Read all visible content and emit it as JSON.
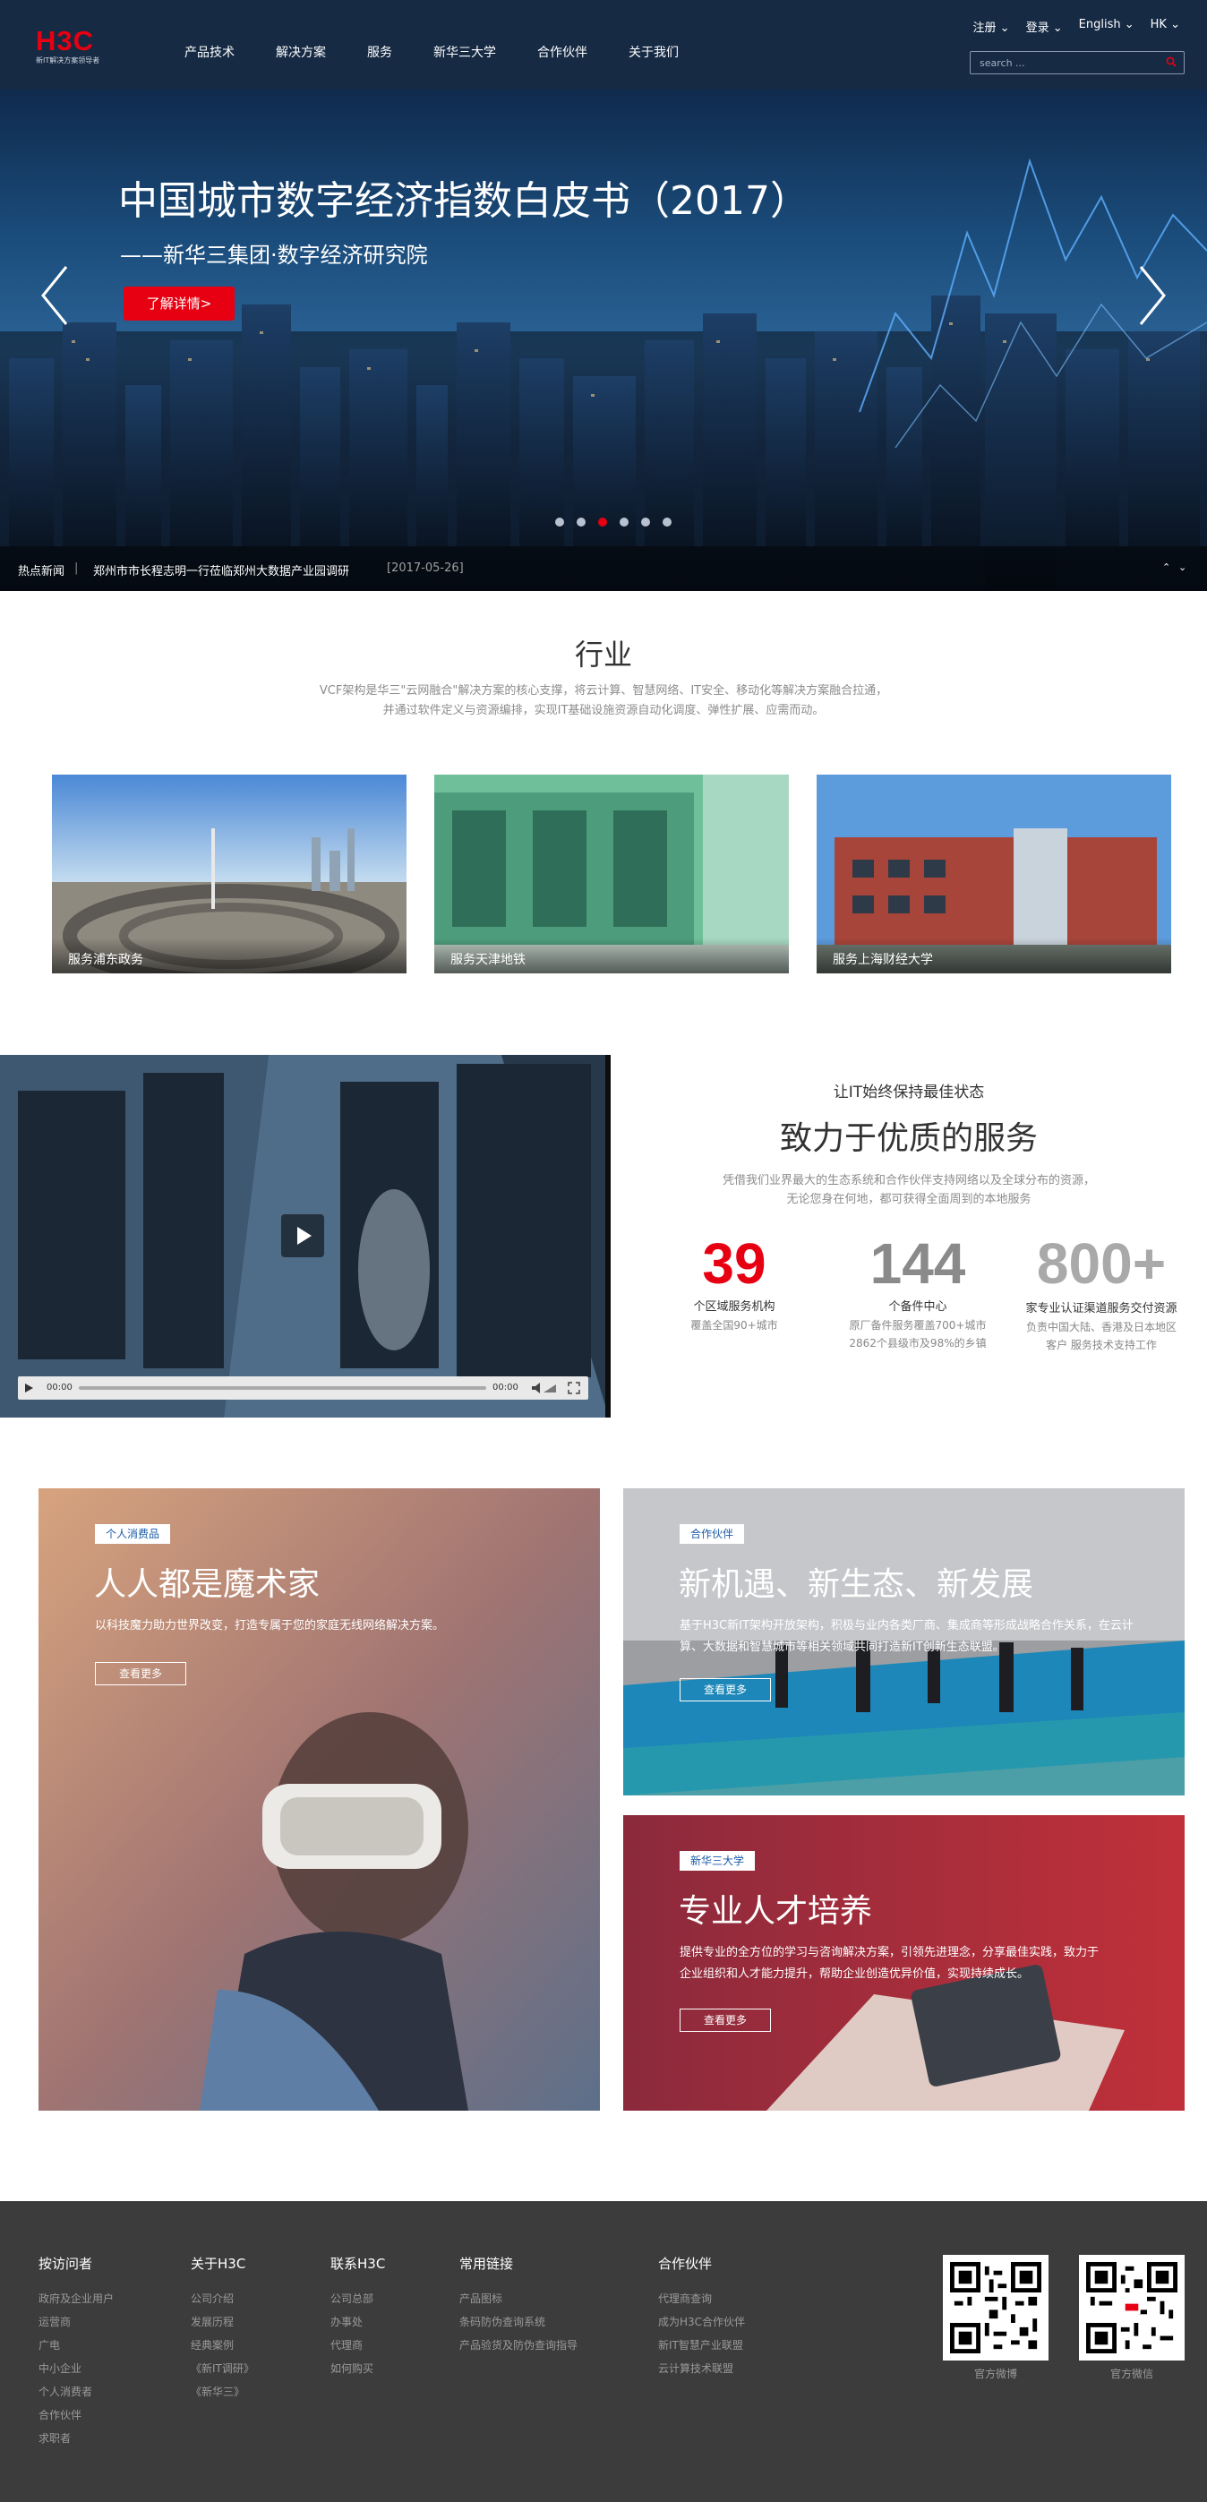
{
  "header": {
    "logo_text": "H3C",
    "logo_tagline": "新IT解决方案领导者",
    "nav": [
      "产品技术",
      "解决方案",
      "服务",
      "新华三大学",
      "合作伙伴",
      "关于我们"
    ],
    "register": "注册",
    "login": "登录",
    "language": "English",
    "region": "HK",
    "search_placeholder": "search ..."
  },
  "hero": {
    "title": "中国城市数字经济指数白皮书（2017）",
    "subtitle": "——新华三集团·数字经济研究院",
    "button": "了解详情>",
    "slide_count": 6,
    "active_slide": 2,
    "news_label": "热点新闻",
    "news_text": "郑州市市长程志明一行莅临郑州大数据产业园调研",
    "news_date": "[2017-05-26]"
  },
  "industry": {
    "title": "行业",
    "desc_line1": "VCF架构是华三\"云网融合\"解决方案的核心支撑，将云计算、智慧网络、IT安全、移动化等解决方案融合拉通，",
    "desc_line2": "并通过软件定义与资源编排，实现IT基础设施资源自动化调度、弹性扩展、应需而动。",
    "cards": [
      {
        "caption": "服务浦东政务"
      },
      {
        "caption": "服务天津地铁"
      },
      {
        "caption": "服务上海财经大学"
      }
    ]
  },
  "service": {
    "kicker": "让IT始终保持最佳状态",
    "title": "致力于优质的服务",
    "desc_line1": "凭借我们业界最大的生态系统和合作伙伴支持网络以及全球分布的资源，",
    "desc_line2": "无论您身在何地，都可获得全面周到的本地服务",
    "video_time_start": "00:00",
    "video_time_end": "00:00",
    "stats": [
      {
        "value": "39",
        "label": "个区域服务机构",
        "sub1": "覆盖全国90+城市",
        "sub2": "",
        "color": "#e60012"
      },
      {
        "value": "144",
        "label": "个备件中心",
        "sub1": "原厂备件服务覆盖700+城市",
        "sub2": "2862个县级市及98%的乡镇",
        "color": "#8a8a8a"
      },
      {
        "value": "800+",
        "label": "家专业认证渠道服务交付资源",
        "sub1": "负责中国大陆、香港及日本地区",
        "sub2": "客户 服务技术支持工作",
        "color": "#a9a9a9"
      }
    ]
  },
  "promos": [
    {
      "badge": "个人消费品",
      "title": "人人都是魔术家",
      "text1": "以科技魔力助力世界改变，打造专属于您的家庭无线网络解决方案。",
      "text2": "",
      "button": "查看更多"
    },
    {
      "badge": "合作伙伴",
      "title": "新机遇、新生态、新发展",
      "text1": "基于H3C新IT架构开放架构，积极与业内各类厂商、集成商等形成战略合作关系，在云计",
      "text2": "算、大数据和智慧城市等相关领域共同打造新IT创新生态联盟。",
      "button": "查看更多"
    },
    {
      "badge": "新华三大学",
      "title": "专业人才培养",
      "text1": "提供专业的全方位的学习与咨询解决方案，引领先进理念，分享最佳实践，致力于",
      "text2": "企业组织和人才能力提升，帮助企业创造优异价值，实现持续成长。",
      "button": "查看更多"
    }
  ],
  "footer": {
    "columns": [
      {
        "title": "按访问者",
        "items": [
          "政府及企业用户",
          "运营商",
          "广电",
          "中小企业",
          "个人消费者",
          "合作伙伴",
          "求职者"
        ]
      },
      {
        "title": "关于H3C",
        "items": [
          "公司介绍",
          "发展历程",
          "经典案例",
          "《新IT调研》",
          "《新华三》"
        ]
      },
      {
        "title": "联系H3C",
        "items": [
          "公司总部",
          "办事处",
          "代理商",
          "如何购买"
        ]
      },
      {
        "title": "常用链接",
        "items": [
          "产品图标",
          "条码防伪查询系统",
          "产品验货及防伪查询指导"
        ]
      },
      {
        "title": "合作伙伴",
        "items": [
          "代理商查询",
          "成为H3C合作伙伴",
          "新IT智慧产业联盟",
          "云计算技术联盟"
        ]
      }
    ],
    "qr": [
      {
        "caption": "官方微博"
      },
      {
        "caption": "官方微信"
      }
    ]
  },
  "colors": {
    "brand_red": "#e60012",
    "header_bg": "#162a44",
    "footer_bg": "#3c3c3c"
  }
}
